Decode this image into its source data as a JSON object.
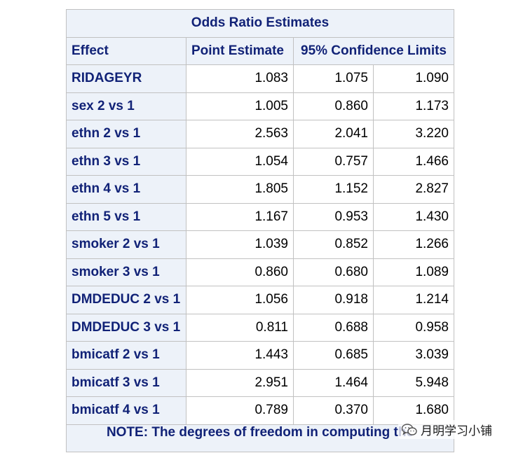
{
  "table": {
    "title": "Odds Ratio Estimates",
    "headers": {
      "effect": "Effect",
      "point_estimate": "Point Estimate",
      "confidence_limits": "95% Confidence Limits"
    },
    "rows": [
      {
        "effect": "RIDAGEYR",
        "estimate": "1.083",
        "lower": "1.075",
        "upper": "1.090"
      },
      {
        "effect": "sex 2 vs 1",
        "estimate": "1.005",
        "lower": "0.860",
        "upper": "1.173"
      },
      {
        "effect": "ethn 2 vs 1",
        "estimate": "2.563",
        "lower": "2.041",
        "upper": "3.220"
      },
      {
        "effect": "ethn 3 vs 1",
        "estimate": "1.054",
        "lower": "0.757",
        "upper": "1.466"
      },
      {
        "effect": "ethn 4 vs 1",
        "estimate": "1.805",
        "lower": "1.152",
        "upper": "2.827"
      },
      {
        "effect": "ethn 5 vs 1",
        "estimate": "1.167",
        "lower": "0.953",
        "upper": "1.430"
      },
      {
        "effect": "smoker 2 vs 1",
        "estimate": "1.039",
        "lower": "0.852",
        "upper": "1.266"
      },
      {
        "effect": "smoker 3 vs 1",
        "estimate": "0.860",
        "lower": "0.680",
        "upper": "1.089"
      },
      {
        "effect": "DMDEDUC 2 vs 1",
        "estimate": "1.056",
        "lower": "0.918",
        "upper": "1.214"
      },
      {
        "effect": "DMDEDUC 3 vs 1",
        "estimate": "0.811",
        "lower": "0.688",
        "upper": "0.958"
      },
      {
        "effect": "bmicatf 2 vs 1",
        "estimate": "1.443",
        "lower": "0.685",
        "upper": "3.039"
      },
      {
        "effect": "bmicatf 3 vs 1",
        "estimate": "2.951",
        "lower": "1.464",
        "upper": "5.948"
      },
      {
        "effect": "bmicatf 4 vs 1",
        "estimate": "0.789",
        "lower": "0.370",
        "upper": "1.680"
      }
    ],
    "note": "NOTE: The degrees of freedom in computing the"
  },
  "watermark": {
    "text": "月明学习小铺",
    "icon": "wechat-icon"
  },
  "colors": {
    "header_bg": "#edf2f9",
    "header_text": "#112277",
    "border": "#c1c1c1"
  }
}
